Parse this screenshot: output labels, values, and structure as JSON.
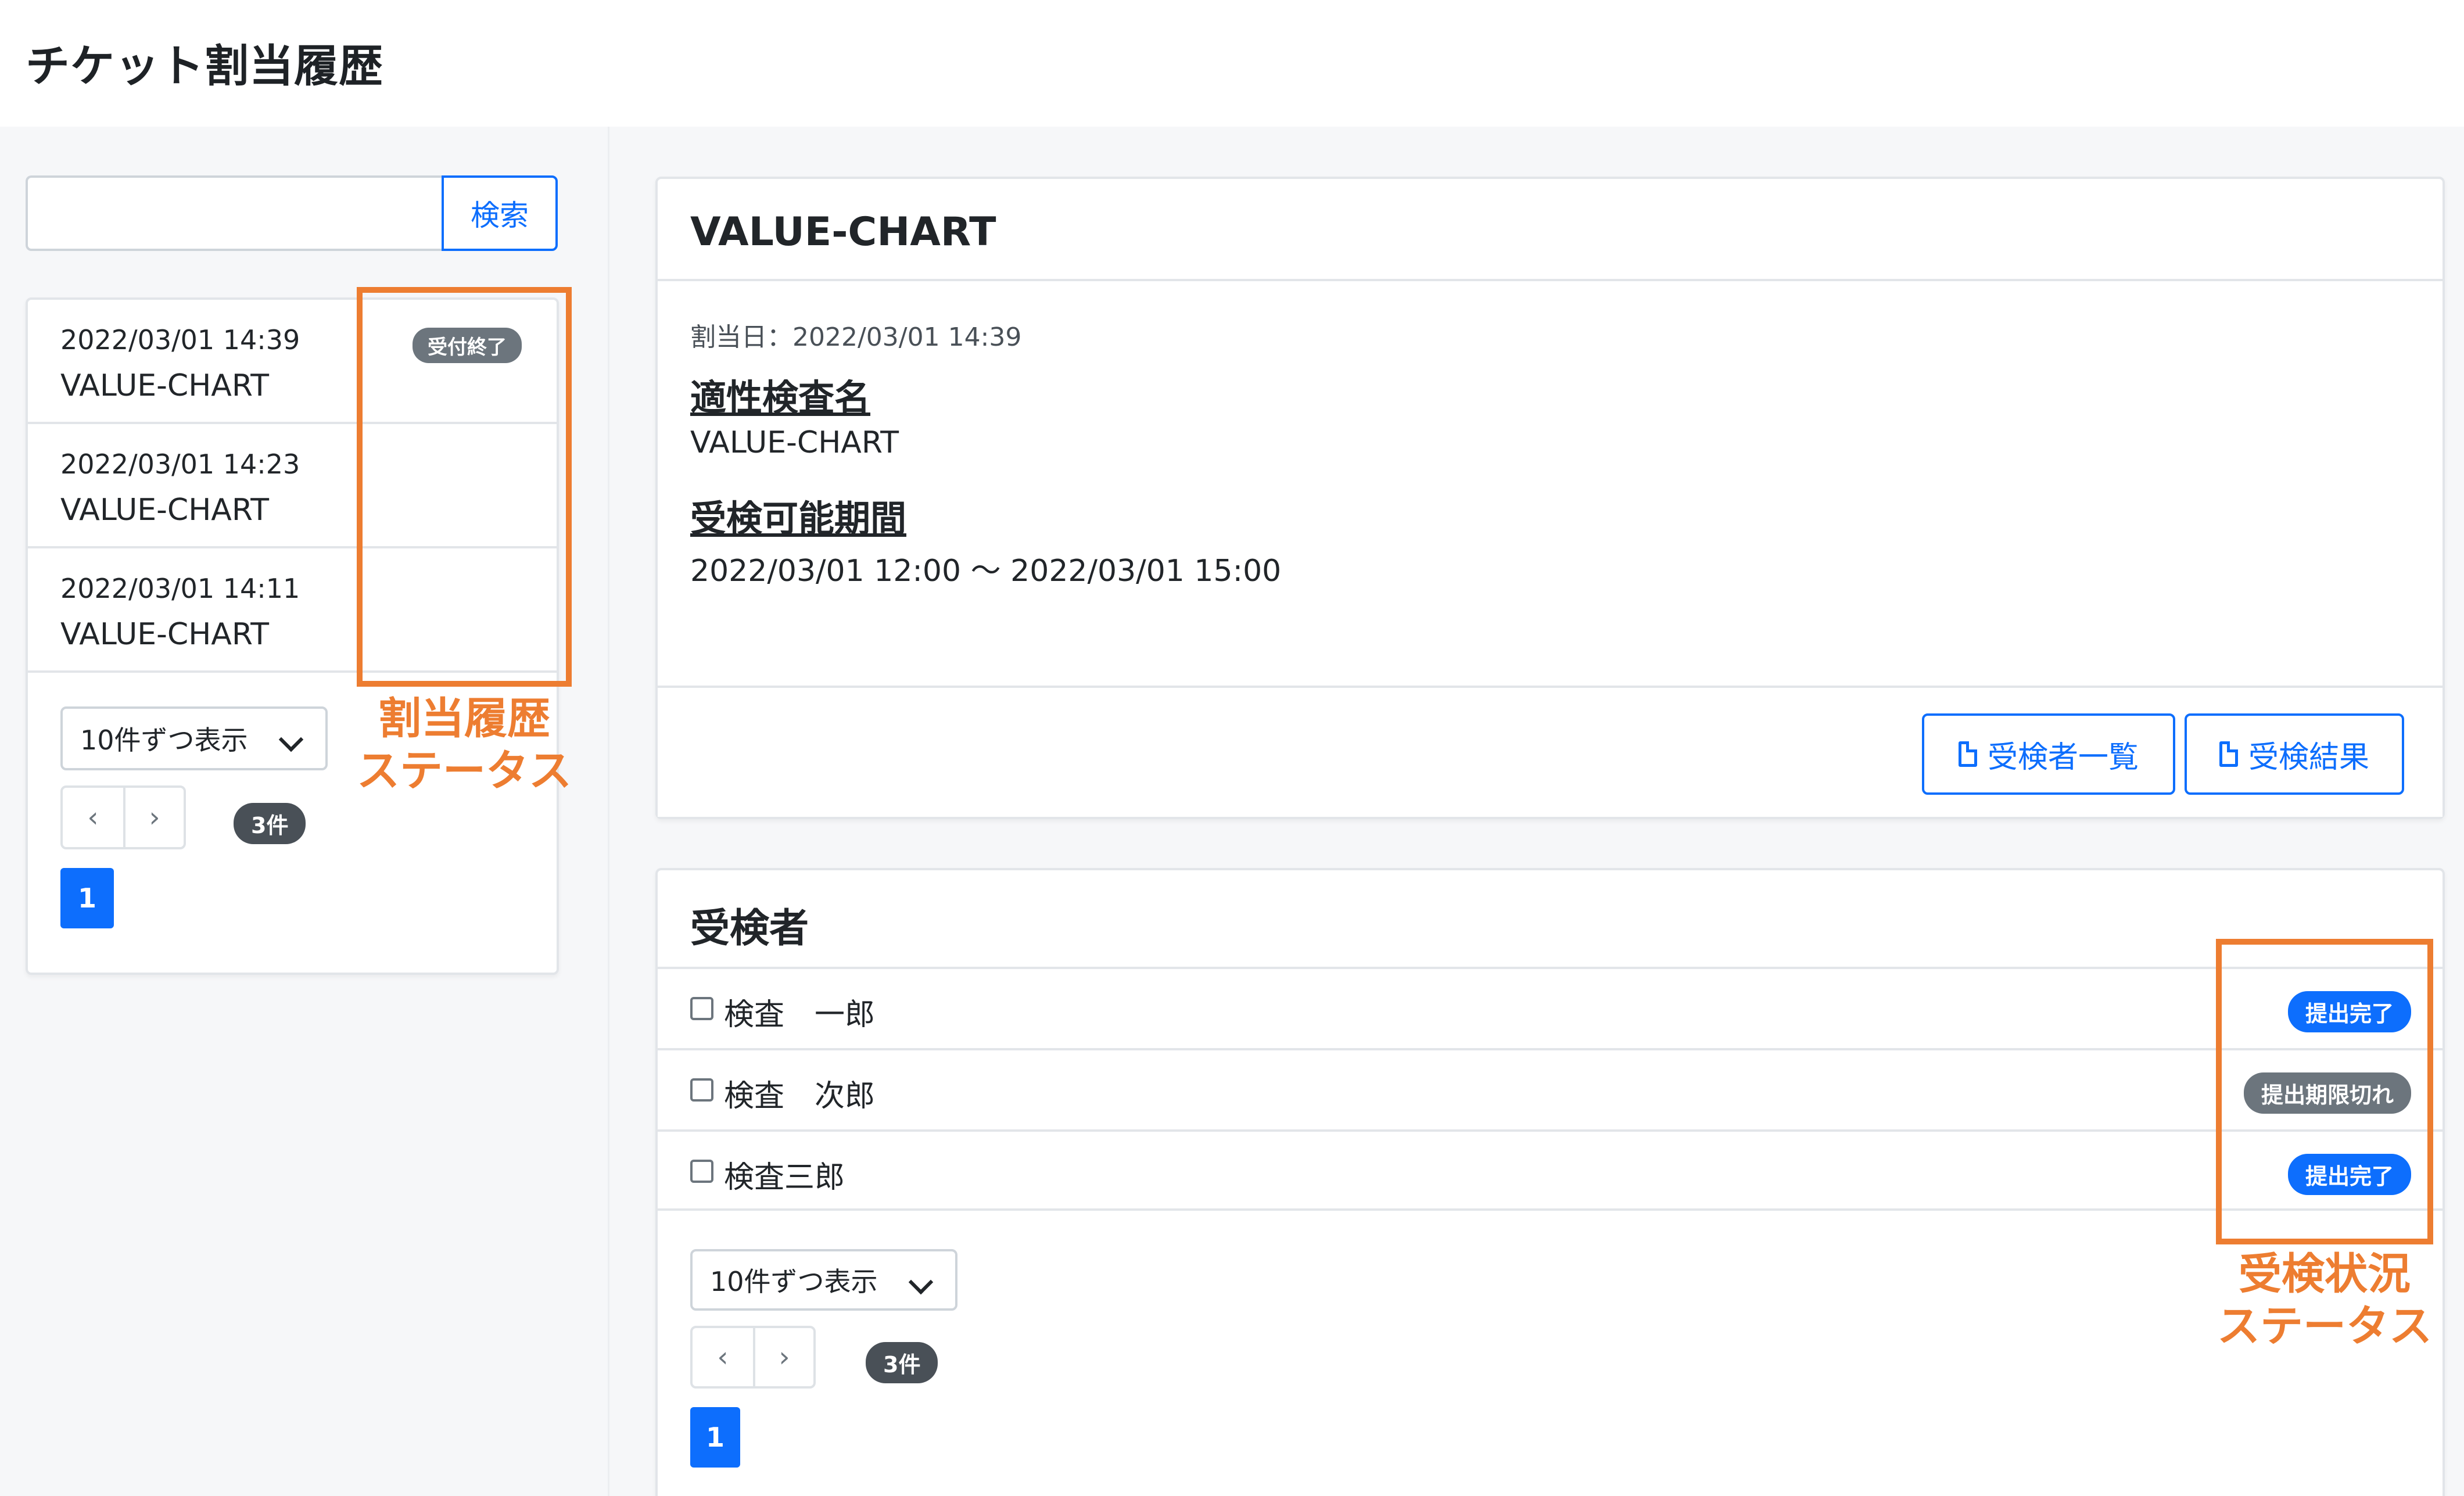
{
  "page": {
    "title": "チケット割当履歴"
  },
  "search": {
    "placeholder": "",
    "button_label": "検索"
  },
  "history": {
    "items": [
      {
        "date": "2022/03/01 14:39",
        "name": "VALUE-CHART",
        "status": "受付終了"
      },
      {
        "date": "2022/03/01 14:23",
        "name": "VALUE-CHART",
        "status": ""
      },
      {
        "date": "2022/03/01 14:11",
        "name": "VALUE-CHART",
        "status": ""
      }
    ],
    "per_page_label": "10件ずつ表示",
    "prev_label": "‹",
    "next_label": "›",
    "count_label": "3件",
    "current_page": "1"
  },
  "annotations": {
    "history_status_line1": "割当履歴",
    "history_status_line2": "ステータス",
    "exam_status_line1": "受検状況",
    "exam_status_line2": "ステータス",
    "color": "#ed7d31"
  },
  "detail": {
    "title": "VALUE-CHART",
    "assign_date": "割当日：2022/03/01 14:39",
    "test_name_heading": "適性検査名",
    "test_name_value": "VALUE-CHART",
    "period_heading": "受検可能期間",
    "period_value": "2022/03/01 12:00 〜 2022/03/01 15:00",
    "examinee_list_button": "受検者一覧",
    "results_button": "受検結果"
  },
  "examinees": {
    "title": "受検者",
    "rows": [
      {
        "name": "検査　一郎",
        "status": "提出完了",
        "status_color": "#0d6efd"
      },
      {
        "name": "検査　次郎",
        "status": "提出期限切れ",
        "status_color": "#6c757d"
      },
      {
        "name": "検査三郎",
        "status": "提出完了",
        "status_color": "#0d6efd"
      }
    ],
    "per_page_label": "10件ずつ表示",
    "prev_label": "‹",
    "next_label": "›",
    "count_label": "3件",
    "current_page": "1"
  },
  "colors": {
    "primary": "#0d6efd",
    "secondary": "#6c757d",
    "accent": "#ed7d31"
  }
}
